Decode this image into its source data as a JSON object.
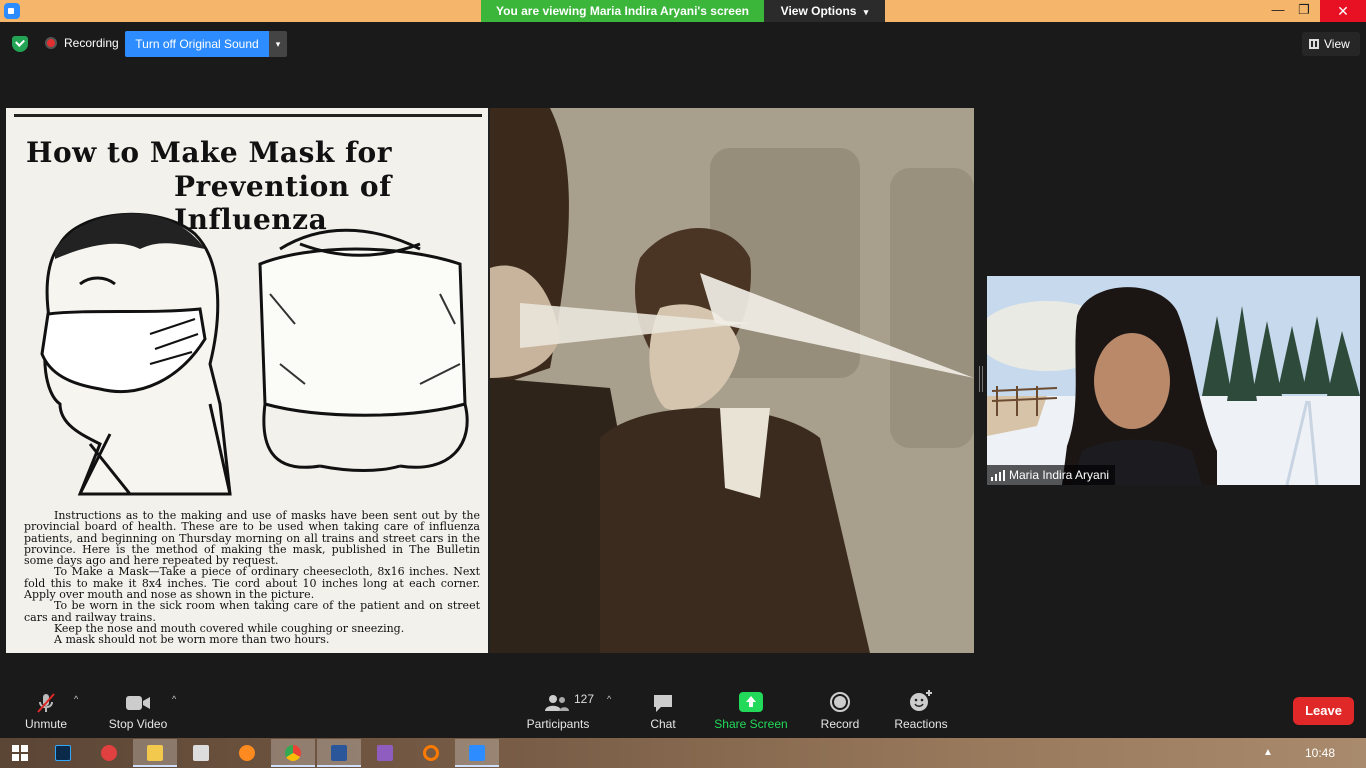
{
  "titlebar": {
    "viewing_banner": "You are viewing Maria Indira Aryani's screen",
    "view_options": "View Options",
    "minimize": "—",
    "restore": "❐",
    "close": "✕"
  },
  "status": {
    "recording": "Recording",
    "original_sound": "Turn off Original Sound",
    "caret": "▾",
    "view": "View"
  },
  "shared_screen": {
    "newspaper": {
      "title_line1": "How to Make Mask for",
      "title_line2": "Prevention of Influenza",
      "paragraphs": [
        "Instructions as to the making and use of masks have been sent out by the provincial board of health. These are to be used when taking care of influenza patients, and beginning on Thursday morning on all trains and street cars in the province. Here is the method of making the mask, published in The Bulletin some days ago and here repeated by request.",
        "To Make a Mask—Take a piece of ordinary cheesecloth, 8x16 inches. Next fold this to make it 8x4 inches. Tie cord about 10 inches long at each corner. Apply over mouth and nose as shown in the picture.",
        "To be worn in the sick room when taking care of the patient and on street cars and railway trains.",
        "Keep the nose and mouth covered while coughing or sneezing.",
        "A mask should not be worn more than two hours."
      ]
    }
  },
  "participant_video": {
    "name": "Maria Indira Aryani"
  },
  "toolbar": {
    "unmute": "Unmute",
    "stop_video": "Stop Video",
    "participants": "Participants",
    "participants_count": "127",
    "chat": "Chat",
    "share_screen": "Share Screen",
    "record": "Record",
    "reactions": "Reactions",
    "leave": "Leave",
    "caret": "^"
  },
  "taskbar": {
    "apps": [
      "windows-start",
      "photoshop",
      "screen-recorder",
      "file-explorer",
      "clapper",
      "firefox",
      "chrome",
      "word",
      "winrar",
      "search-magnifier",
      "zoom"
    ],
    "clock": "10:48",
    "tray_caret": "▲"
  },
  "colors": {
    "banner_green": "#3bb63b",
    "accent_blue": "#2d8cff",
    "share_green": "#23d959",
    "leave_red": "#e02828",
    "title_orange": "#f5b56a"
  }
}
